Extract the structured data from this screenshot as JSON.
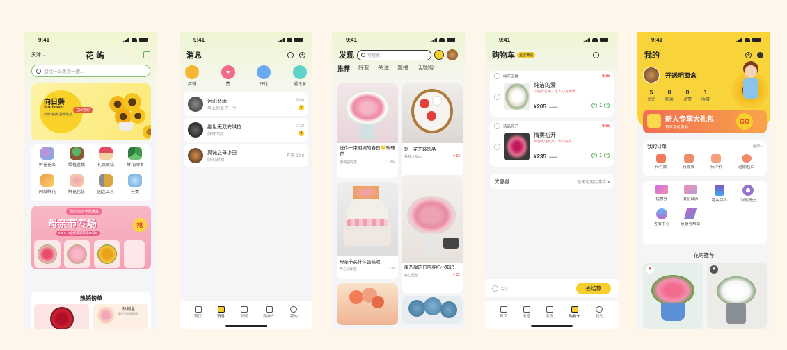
{
  "status": {
    "time": "9:41"
  },
  "screen1": {
    "city": "天津",
    "brand": "花 屿",
    "search_placeholder": "您找什么美境一搜...",
    "banner": {
      "title": "向日葵",
      "sub": "Sunflower",
      "desc": "新鲜采摘 温暖绽放",
      "badge": "立即抢购"
    },
    "categories": [
      "鲜花花束",
      "绿植盆栽",
      "礼品蛋糕",
      "鲜花回收",
      "同城鲜花",
      "鲜花包装",
      "园艺工具",
      "分类"
    ],
    "promo": {
      "top": "限时活动·全场满减",
      "title": "母亲节专场",
      "sub": "5.3-5.14全场满减新满20减5",
      "btn": "抢"
    },
    "hot_title": "热销榜单",
    "hot_badge": "热销量",
    "hot_sub": "最近销售量最高"
  },
  "screen2": {
    "title": "消息",
    "quick": [
      "店铺",
      "赞",
      "评论",
      "通讯录"
    ],
    "messages": [
      {
        "name": "远山悲雨",
        "preview": "早上你发了一个",
        "time": "9:08",
        "count": "2"
      },
      {
        "name": "绝世无双安琪拉",
        "preview": "好呀回复",
        "time": "7:23",
        "count": "3"
      },
      {
        "name": "真诚之母小田",
        "preview": "好的谢谢",
        "time": "昨天 23:8",
        "count": ""
      }
    ],
    "tabs": [
      "首页",
      "消息",
      "发现",
      "购物车",
      "我的"
    ]
  },
  "screen3": {
    "title": "发现",
    "search_placeholder": "写搜索",
    "tabs": [
      "推荐",
      "好友",
      "关注",
      "直播",
      "话题购"
    ],
    "posts": [
      {
        "title": "送你一束明媚的春日💛玫瑰花",
        "author": "加油宝的花",
        "likes": "102"
      },
      {
        "title": "刺土花艺装饰品",
        "author": "喜欢少女心",
        "likes": "52"
      },
      {
        "title": "母亲节买什么蛋糕呢",
        "author": "开心小朋友",
        "likes": "68"
      },
      {
        "title": "康乃馨的日常养护小知识",
        "author": "好心园艺",
        "likes": "32"
      }
    ],
    "tabs_bottom": [
      "首页",
      "消息",
      "发现",
      "购物车",
      "我的"
    ]
  },
  "screen4": {
    "title": "购物车",
    "badge": "全店满减",
    "items": [
      {
        "store": "鲜花店铺",
        "tag": "编辑",
        "name": "纯洁的爱",
        "note": "白色鲜花束，送人心意满满",
        "price": "¥205",
        "old": "¥165",
        "qty": "1"
      },
      {
        "store": "精品花艺",
        "tag": "编辑",
        "name": "情窦初开",
        "note": "粉色玫瑰花束，表白好礼",
        "price": "¥235",
        "old": "¥895",
        "qty": "1"
      }
    ],
    "coupon": "优惠券",
    "coupon_val": "暂无可用优惠券",
    "total": "合计",
    "checkout": "去结算",
    "tabs": [
      "首页",
      "消息",
      "发现",
      "购物车",
      "我的"
    ]
  },
  "screen5": {
    "title": "我的",
    "user": "开透明窗盒",
    "stats": [
      {
        "n": "5",
        "l": "关注"
      },
      {
        "n": "0",
        "l": "粉丝"
      },
      {
        "n": "0",
        "l": "点赞"
      },
      {
        "n": "1",
        "l": "收藏"
      }
    ],
    "gift": {
      "title": "新人专享大礼包",
      "sub": "首单享优惠券",
      "btn": "GO"
    },
    "orders_title": "我的订单",
    "orders_all": "全部",
    "orders": [
      "待付款",
      "待收货",
      "待评价",
      "退款/售后"
    ],
    "services": [
      "优惠券",
      "收花日历",
      "花卉百科",
      "浏览历史",
      "客服中心",
      "反馈与帮助"
    ],
    "recommend": "花屿推荐"
  },
  "colors": {
    "accent": "#f7cf2c",
    "green": "#5cb85c",
    "pink": "#f25c7b",
    "red": "#e53935"
  }
}
